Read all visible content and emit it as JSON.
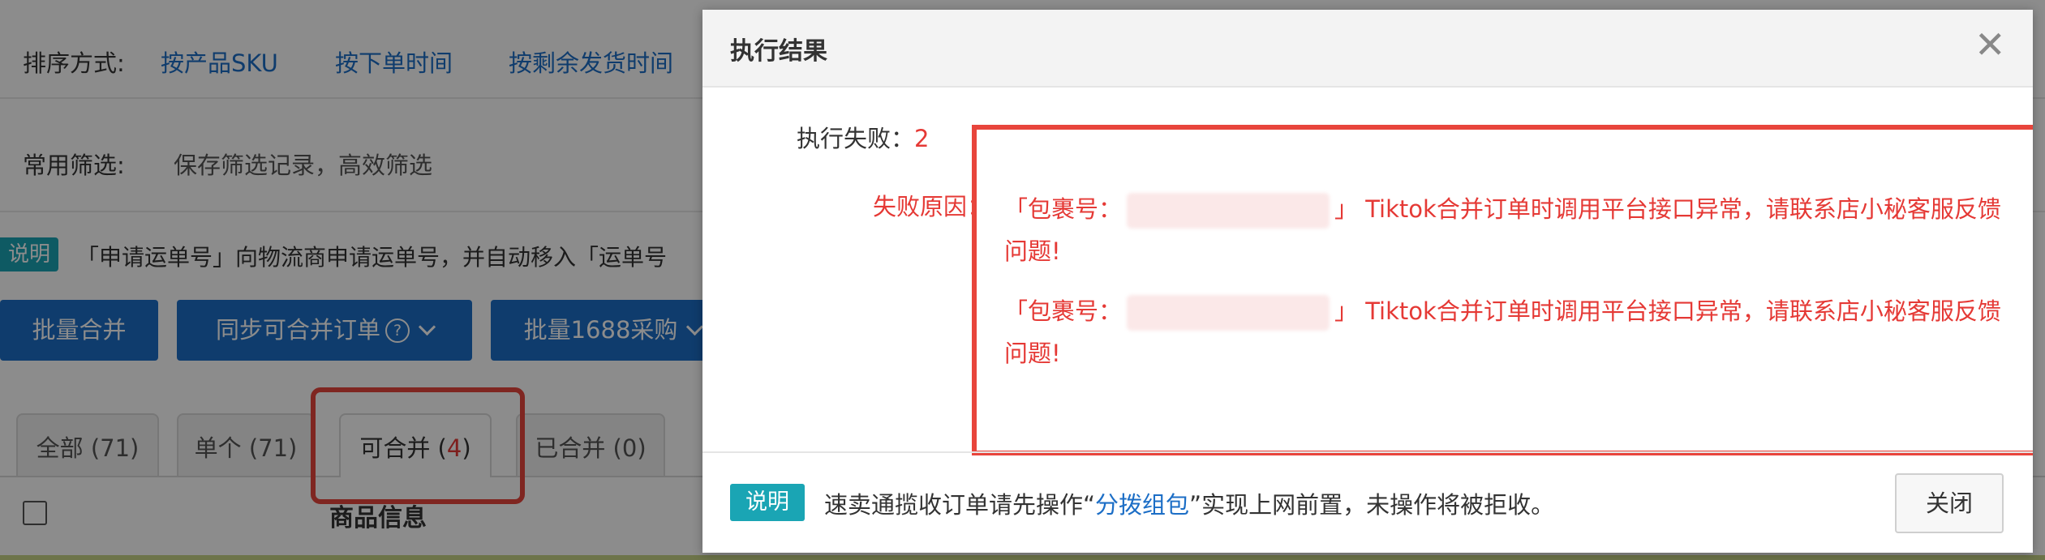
{
  "sort": {
    "label": "排序方式:",
    "options": [
      "按产品SKU",
      "按下单时间",
      "按剩余发货时间"
    ]
  },
  "filter": {
    "label": "常用筛选:",
    "value": "保存筛选记录，高效筛选"
  },
  "tip": {
    "badge": "说明",
    "text": "「申请运单号」向物流商申请运单号，并自动移入「运单号"
  },
  "toolbar": {
    "batch_merge": "批量合并",
    "sync_merge": "同步可合并订单",
    "batch_1688": "批量1688采购"
  },
  "tabs": [
    {
      "label": "全部 (71)"
    },
    {
      "label": "单个 (71)"
    },
    {
      "label": "可合并 (",
      "count": "4",
      "suffix": ")"
    },
    {
      "label": "已合并 (0)"
    }
  ],
  "table": {
    "col_product": "商品信息"
  },
  "dialog": {
    "title": "执行结果",
    "fail_label": "执行失败：",
    "fail_count": "2",
    "reason_label": "失败原因：",
    "reasons": [
      {
        "pre": "「包裹号：",
        "post": "」 Tiktok合并订单时调用平台接口异常，请联系店小秘客服反馈问题!"
      },
      {
        "pre": "「包裹号：",
        "post": "」 Tiktok合并订单时调用平台接口异常，请联系店小秘客服反馈问题!"
      }
    ],
    "footer": {
      "badge": "说明",
      "text_before": "速卖通揽收订单请先操作“",
      "link": "分拨组包",
      "text_after": "”实现上网前置，未操作将被拒收。",
      "close_button": "关闭"
    }
  },
  "colors": {
    "accent_blue": "#1c6ec6",
    "error_red": "#e53935",
    "highlight_red": "#e8453c",
    "teal_badge": "#1aa5b4"
  }
}
